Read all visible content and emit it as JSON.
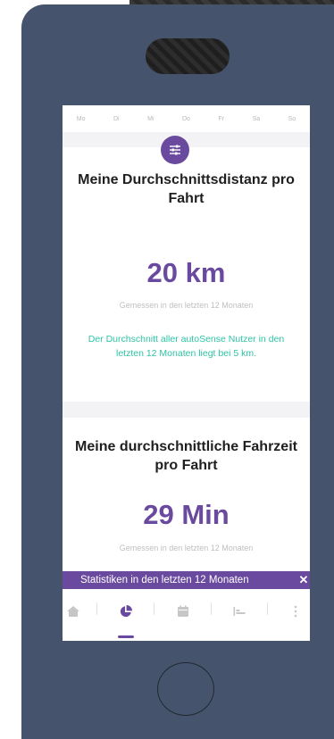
{
  "weekdays": [
    "Mo",
    "Di",
    "Mi",
    "Do",
    "Fr",
    "Sa",
    "So"
  ],
  "card1": {
    "title": "Meine Durchschnittsdistanz pro Fahrt",
    "value": "20 km",
    "caption": "Gemessen in den letzten 12 Monaten",
    "note": "Der Durchschnitt aller autoSense Nutzer in den letzten 12 Monaten liegt bei 5 km."
  },
  "card2": {
    "title": "Meine durchschnittliche Fahrzeit pro Fahrt",
    "value": "29 Min",
    "caption": "Gemessen in den letzten 12 Monaten"
  },
  "banner": {
    "text": "Statistiken in den letzten 12 Monaten",
    "close": "✕"
  },
  "tabs": [
    {
      "icon": "home-icon",
      "active": false
    },
    {
      "icon": "pie-chart-icon",
      "active": true
    },
    {
      "icon": "calendar-icon",
      "active": false
    },
    {
      "icon": "timeline-icon",
      "active": false
    },
    {
      "icon": "more-vertical-icon",
      "active": false
    }
  ],
  "colors": {
    "accent": "#6a4a9e",
    "teal": "#2ec4a6",
    "phone_body": "#45536d"
  }
}
